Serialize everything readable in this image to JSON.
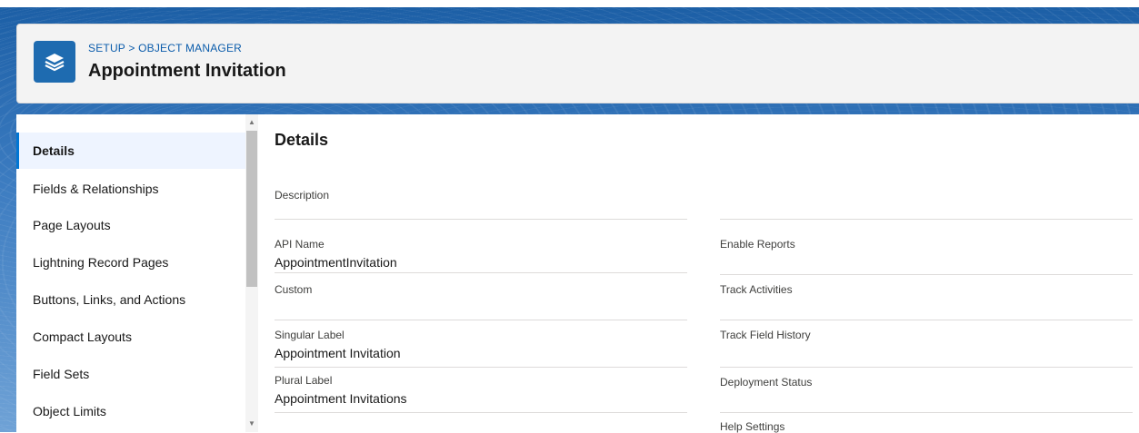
{
  "header": {
    "breadcrumb": {
      "setup": "SETUP",
      "separator": ">",
      "object_manager": "OBJECT MANAGER"
    },
    "title": "Appointment Invitation",
    "icon": "layers-icon",
    "icon_color": "#1e6bb0"
  },
  "sidebar": {
    "items": [
      {
        "label": "Details",
        "active": true
      },
      {
        "label": "Fields & Relationships"
      },
      {
        "label": "Page Layouts"
      },
      {
        "label": "Lightning Record Pages"
      },
      {
        "label": "Buttons, Links, and Actions"
      },
      {
        "label": "Compact Layouts"
      },
      {
        "label": "Field Sets"
      },
      {
        "label": "Object Limits"
      }
    ]
  },
  "details": {
    "title": "Details",
    "left": [
      {
        "label": "Description",
        "value": ""
      },
      {
        "label": "API Name",
        "value": "AppointmentInvitation"
      },
      {
        "label": "Custom",
        "value": ""
      },
      {
        "label": "Singular Label",
        "value": "Appointment Invitation"
      },
      {
        "label": "Plural Label",
        "value": "Appointment Invitations"
      }
    ],
    "right": [
      {
        "label": "Enable Reports",
        "value": ""
      },
      {
        "label": "Track Activities",
        "value": ""
      },
      {
        "label": "Track Field History",
        "value": ""
      },
      {
        "label": "Deployment Status",
        "value": ""
      },
      {
        "label": "Help Settings",
        "value": ""
      }
    ]
  },
  "colors": {
    "accent": "#0176d3",
    "breadcrumb": "#0b5cab",
    "active_nav_bg": "#eef4ff"
  }
}
